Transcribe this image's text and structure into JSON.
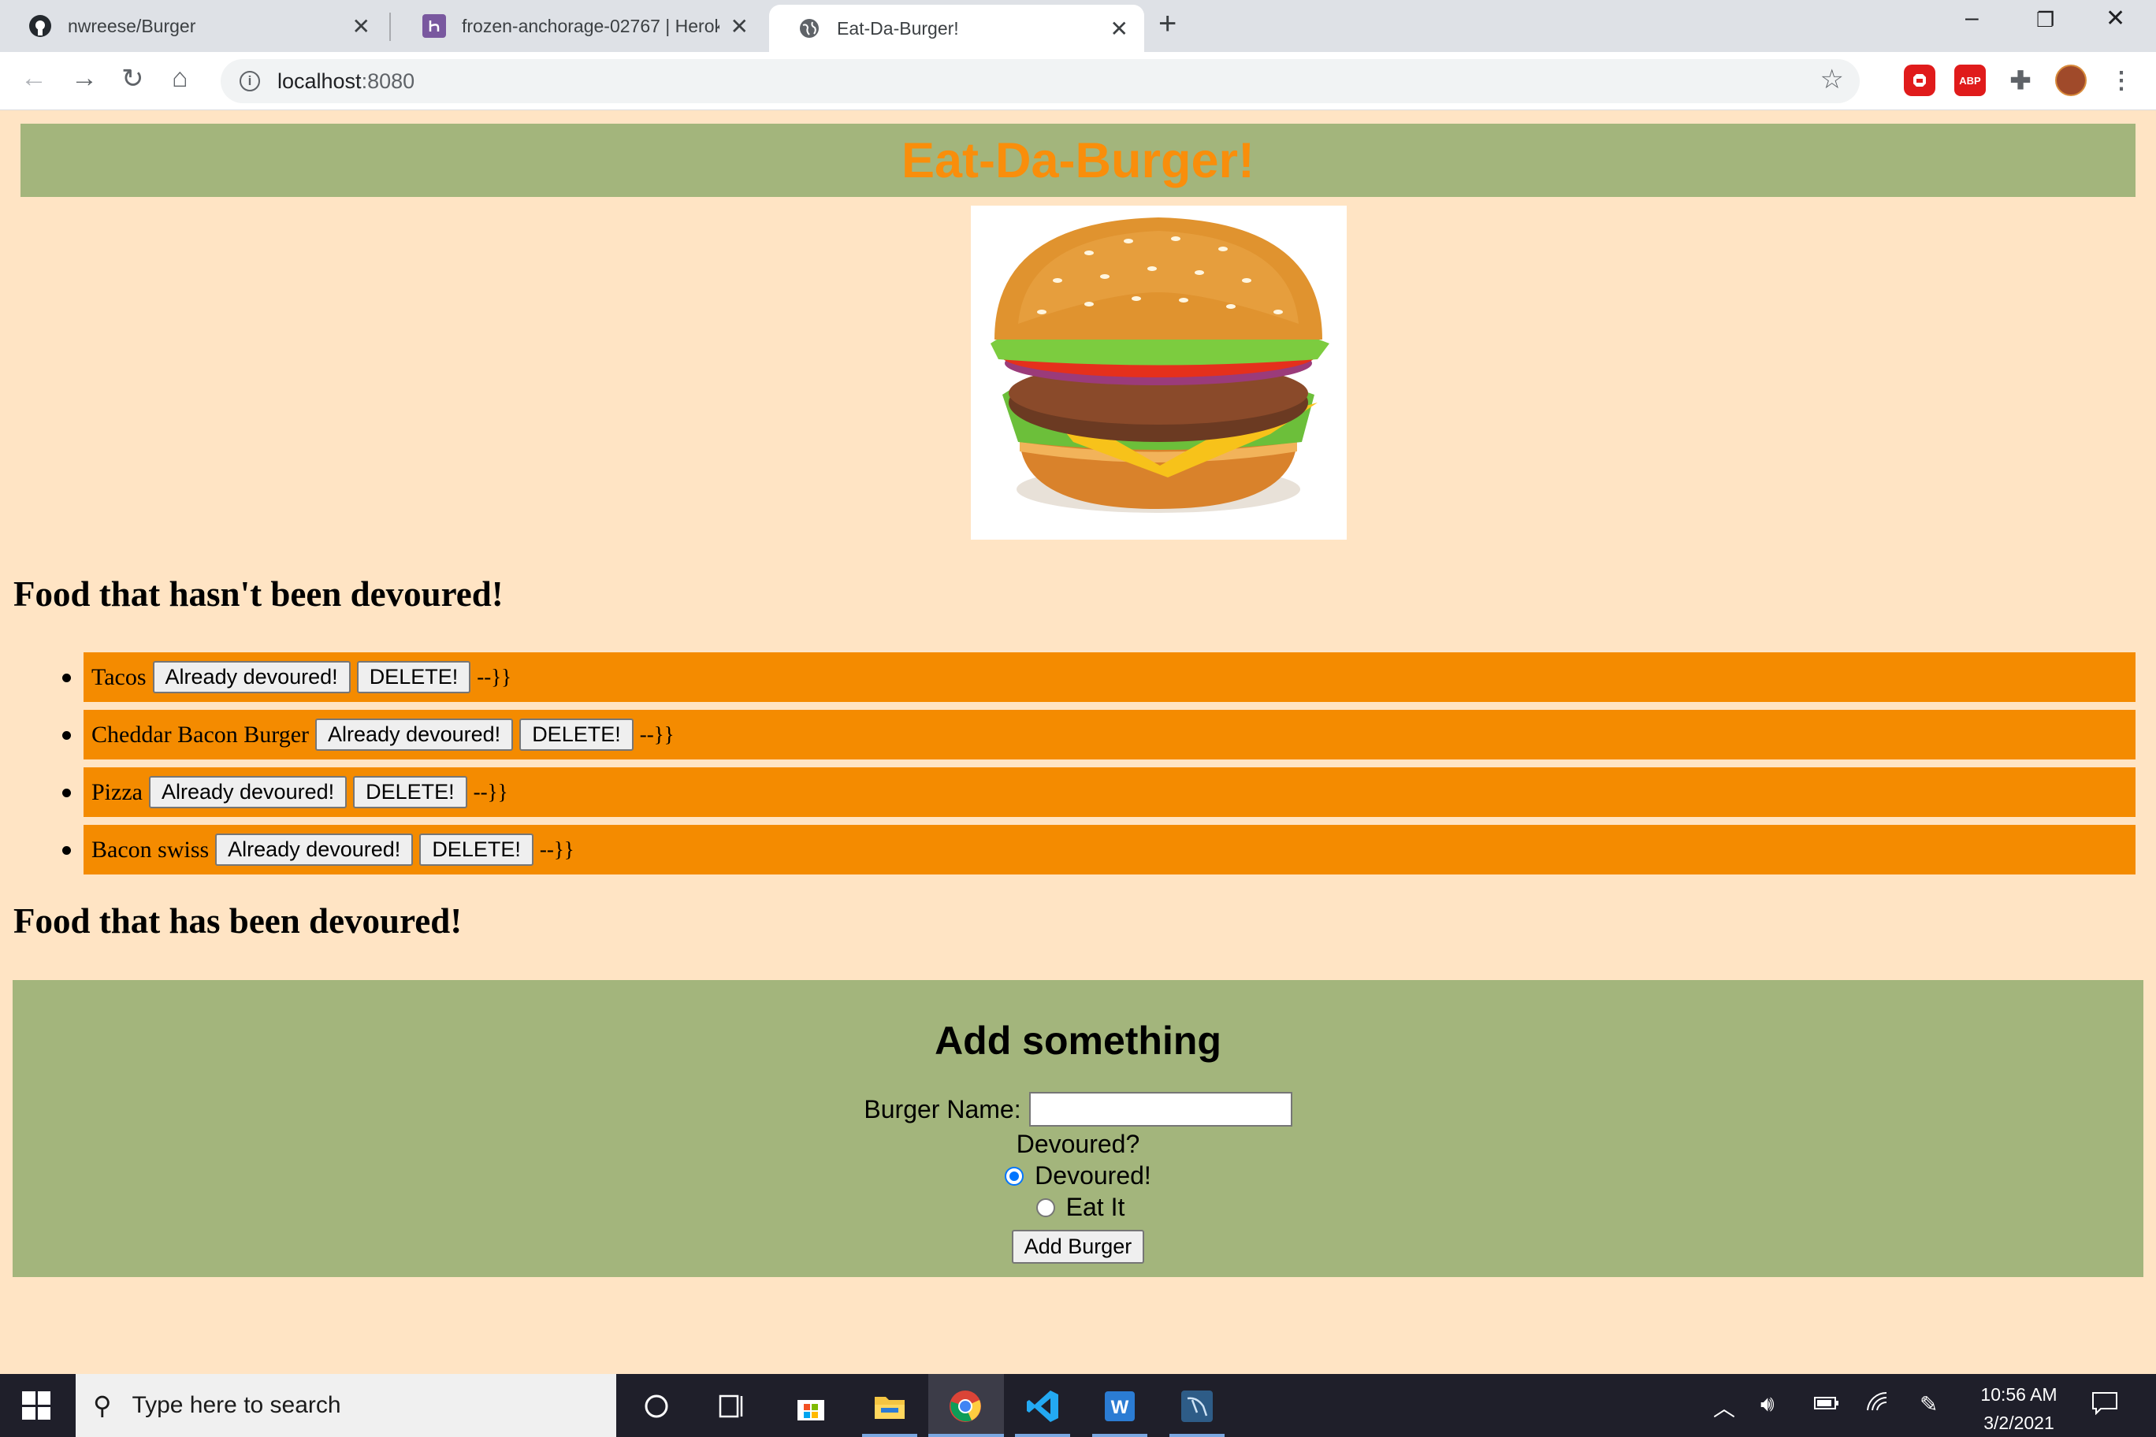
{
  "browser": {
    "tabs": [
      {
        "title": "nwreese/Burger",
        "icon": "github-icon"
      },
      {
        "title": "frozen-anchorage-02767 | Herok",
        "icon": "heroku-icon"
      },
      {
        "title": "Eat-Da-Burger!",
        "icon": "globe-icon"
      }
    ],
    "url_host": "localhost",
    "url_port": ":8080",
    "extensions": [
      "adblock-stop-icon",
      "abp-icon",
      "puzzle-icon",
      "profile-avatar"
    ],
    "abp_label": "ABP"
  },
  "page": {
    "title": "Eat-Da-Burger!",
    "colors": {
      "header_bg": "#a3b57c",
      "title": "#f98e0b",
      "item_bg": "#f48b00",
      "page_bg": "#ffe4c4"
    },
    "not_devoured_heading": "Food that hasn't been devoured!",
    "devoured_heading": "Food that has been devoured!",
    "burgers": [
      {
        "name": "Tacos",
        "devour_label": "Already devoured!",
        "delete_label": "DELETE!",
        "tail": "--}}"
      },
      {
        "name": "Cheddar Bacon Burger",
        "devour_label": "Already devoured!",
        "delete_label": "DELETE!",
        "tail": "--}}"
      },
      {
        "name": "Pizza",
        "devour_label": "Already devoured!",
        "delete_label": "DELETE!",
        "tail": "--}}"
      },
      {
        "name": "Bacon swiss",
        "devour_label": "Already devoured!",
        "delete_label": "DELETE!",
        "tail": "--}}"
      }
    ],
    "form": {
      "heading": "Add something",
      "name_label": "Burger Name:",
      "name_value": "",
      "devoured_label": "Devoured?",
      "option_devoured": "Devoured!",
      "option_eat": "Eat It",
      "selected": "Devoured!",
      "submit_label": "Add Burger"
    }
  },
  "taskbar": {
    "search_placeholder": "Type here to search",
    "time": "10:56 AM",
    "date": "3/2/2021",
    "apps": [
      "cortana-icon",
      "task-view-icon",
      "store-icon",
      "file-explorer-icon",
      "chrome-icon",
      "vscode-icon",
      "word-icon",
      "mysql-workbench-icon"
    ]
  }
}
